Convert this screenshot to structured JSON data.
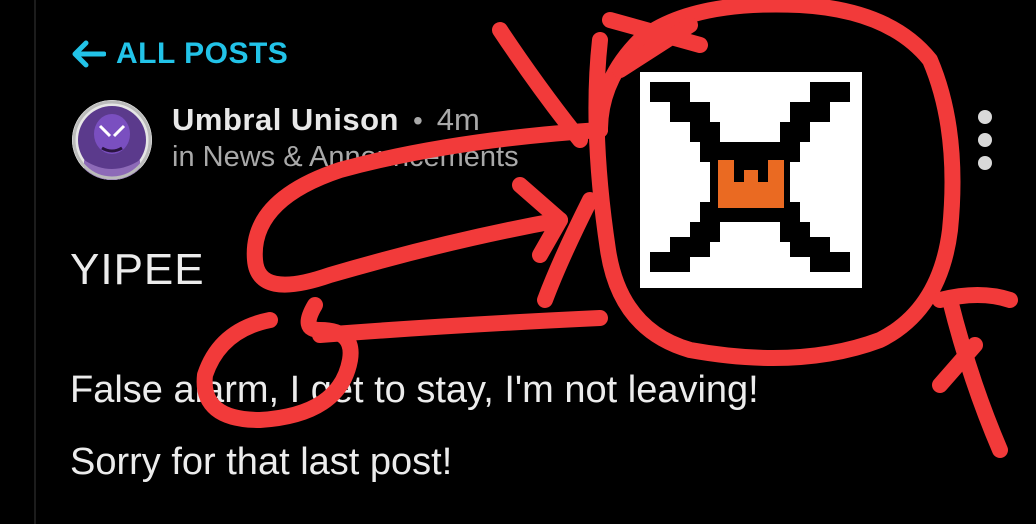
{
  "nav": {
    "back_label": "ALL POSTS",
    "back_icon": "arrow-left-icon"
  },
  "post": {
    "author": "Umbral Unison",
    "separator": "•",
    "time": "4m",
    "category_text": "in News & Announcements",
    "title": "YIPEE",
    "body": [
      "False alarm, I get to stay, I'm not leaving!",
      "Sorry for that last post!"
    ]
  },
  "menu": {
    "icon": "more-vertical-icon"
  },
  "overlay": {
    "sticker": "pixel-x-crown-icon",
    "annotation": "red-freehand-scribble"
  },
  "colors": {
    "background": "#000000",
    "accent": "#22c3e8",
    "text": "#ececec",
    "muted": "#a9a9a9",
    "scribble": "#f23a3a",
    "sticker_orange": "#ea6a22"
  }
}
